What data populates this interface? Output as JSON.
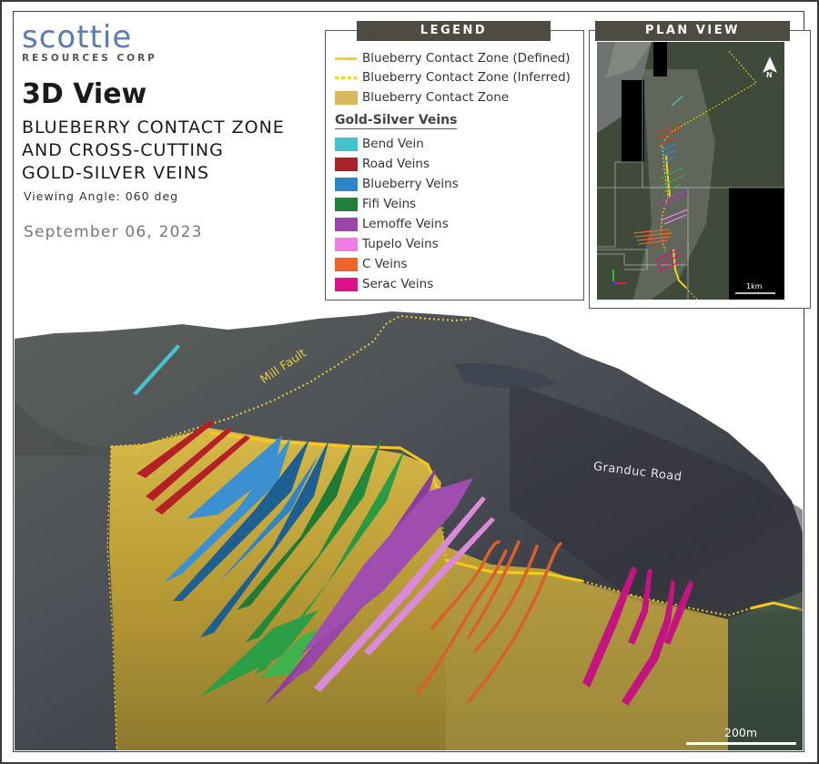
{
  "logo": {
    "name": "scottie",
    "subtitle": "RESOURCES CORP"
  },
  "header": {
    "title": "3D View",
    "subtitle_lines": [
      "BLUEBERRY CONTACT ZONE",
      "AND CROSS-CUTTING",
      "GOLD-SILVER VEINS"
    ],
    "viewing_angle": "Viewing Angle: 060 deg",
    "date": "September 06, 2023"
  },
  "legend": {
    "title": "LEGEND",
    "contact_items": [
      {
        "label": "Blueberry Contact Zone (Defined)",
        "symbol": "solid-line",
        "color": "#f4d31c"
      },
      {
        "label": "Blueberry Contact Zone (Inferred)",
        "symbol": "dashed-line",
        "color": "#f4d31c"
      },
      {
        "label": "Blueberry Contact Zone",
        "symbol": "fill",
        "color": "#d8b85a"
      }
    ],
    "veins_heading": "Gold-Silver Veins",
    "veins": [
      {
        "label": "Bend Vein",
        "color": "#45c3cc"
      },
      {
        "label": "Road Veins",
        "color": "#a8232a"
      },
      {
        "label": "Blueberry Veins",
        "color": "#2b86c8"
      },
      {
        "label": "Fifi Veins",
        "color": "#23803a"
      },
      {
        "label": "Lemoffe Veins",
        "color": "#9a45a8"
      },
      {
        "label": "Tupelo Veins",
        "color": "#ee7ee6"
      },
      {
        "label": "C Veins",
        "color": "#f0642a"
      },
      {
        "label": "Serac Veins",
        "color": "#e0128a"
      }
    ]
  },
  "plan_view": {
    "title": "PLAN VIEW",
    "north_label": "N",
    "scale_label": "1km"
  },
  "scene": {
    "labels": {
      "mill_fault": "Mill Fault",
      "granduc_road": "Granduc Road"
    },
    "scale_label": "200m"
  }
}
